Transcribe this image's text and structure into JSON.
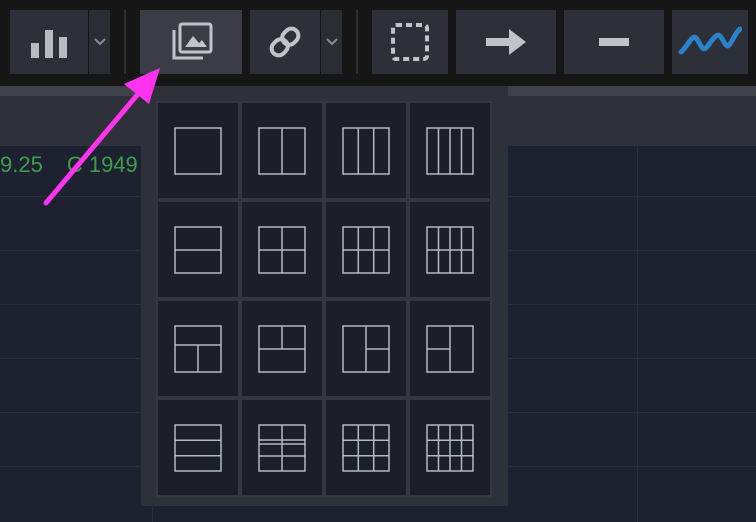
{
  "toolbar": {
    "buttons": [
      {
        "name": "chart-type",
        "icon": "bar-chart-icon",
        "has_dropdown": true
      },
      {
        "name": "layout",
        "icon": "layout-images-icon",
        "has_dropdown": false,
        "active": true
      },
      {
        "name": "link",
        "icon": "link-icon",
        "has_dropdown": true
      },
      {
        "name": "selection",
        "icon": "dashed-square-icon",
        "has_dropdown": false
      },
      {
        "name": "arrow-tool",
        "icon": "arrow-right-icon",
        "has_dropdown": false
      },
      {
        "name": "line-tool",
        "icon": "minus-icon",
        "has_dropdown": false
      },
      {
        "name": "brand",
        "icon": "wave-logo-icon",
        "has_dropdown": false
      }
    ]
  },
  "price": {
    "value": "9.25",
    "close_label": "C 1949"
  },
  "layout_panel": {
    "options": [
      "single",
      "two-columns",
      "three-columns",
      "four-columns",
      "two-rows",
      "two-by-two",
      "three-by-two",
      "four-by-two",
      "top-plus-two-bottom",
      "two-top-plus-bottom",
      "left-plus-two-right",
      "two-left-plus-right",
      "three-rows",
      "grid-2x2-split",
      "grid-3x3",
      "grid-4x3"
    ]
  },
  "colors": {
    "background": "#1e2230",
    "toolbar": "#161616",
    "button": "#2d3038",
    "panel": "#2e3139",
    "annotation_arrow": "#ff33ee",
    "price_green": "#3c9e4d",
    "brand_blue": "#2a83c8"
  }
}
